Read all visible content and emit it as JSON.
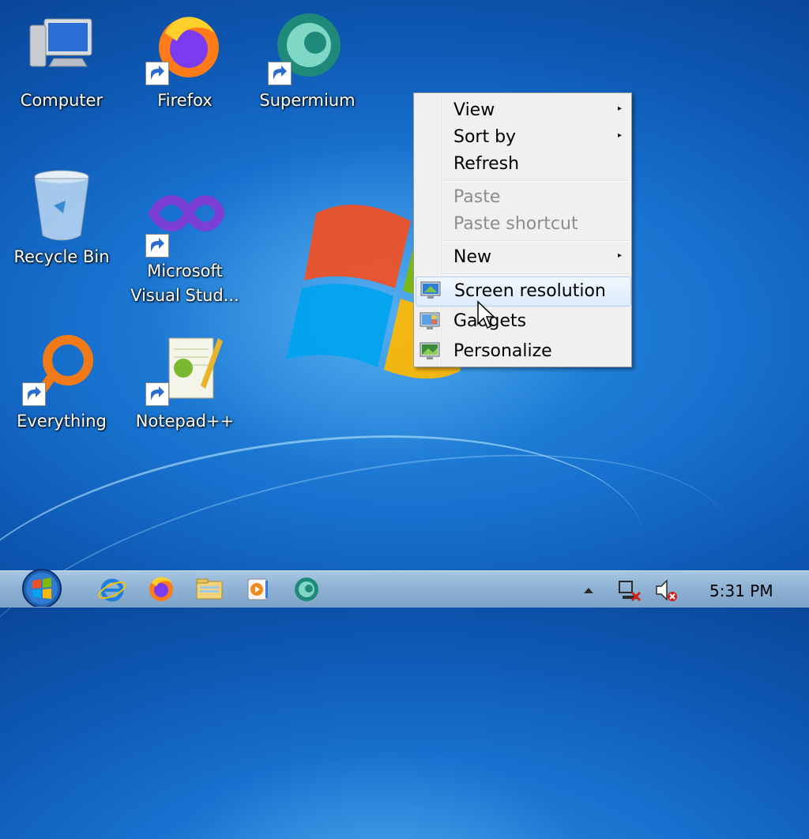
{
  "desktop": {
    "icons": [
      {
        "label": "Computer"
      },
      {
        "label": "Firefox"
      },
      {
        "label": "Supermium"
      },
      {
        "label": "Recycle Bin"
      },
      {
        "label": "Microsoft Visual Stud..."
      },
      {
        "label": "Everything"
      },
      {
        "label": "Notepad++"
      }
    ]
  },
  "context_menu": {
    "items": [
      {
        "label": "View",
        "submenu": true,
        "enabled": true
      },
      {
        "label": "Sort by",
        "submenu": true,
        "enabled": true
      },
      {
        "label": "Refresh",
        "enabled": true
      },
      {
        "label": "Paste",
        "enabled": false
      },
      {
        "label": "Paste shortcut",
        "enabled": false
      },
      {
        "label": "New",
        "submenu": true,
        "enabled": true
      },
      {
        "label": "Screen resolution",
        "enabled": true,
        "highlighted": true,
        "icon": "monitor-icon"
      },
      {
        "label": "Gadgets",
        "enabled": true,
        "icon": "gadgets-icon"
      },
      {
        "label": "Personalize",
        "enabled": true,
        "icon": "personalize-icon"
      }
    ],
    "submenu_arrow": "▸"
  },
  "taskbar": {
    "pinned": [
      "internet-explorer-icon",
      "firefox-icon",
      "file-explorer-icon",
      "media-player-icon",
      "supermium-icon"
    ],
    "tray": {
      "clock": "5:31 PM",
      "icons": [
        "show-hidden-icons",
        "network-disconnected-icon",
        "volume-muted-icon"
      ]
    }
  }
}
